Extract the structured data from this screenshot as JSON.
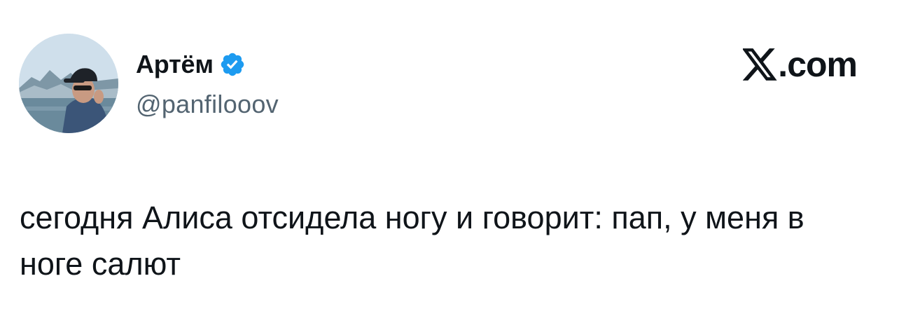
{
  "author": {
    "display_name": "Артём",
    "handle": "@panfilooov",
    "verified": true,
    "verified_icon": "verified-badge-icon",
    "avatar": "profile-photo"
  },
  "brand": {
    "logo_icon": "x-logo-icon",
    "domain": ".com"
  },
  "tweet": {
    "text": "сегодня Алиса отсидела ногу и говорит: пап, у меня в ноге салют"
  },
  "colors": {
    "text_primary": "#0f1419",
    "text_secondary": "#536471",
    "verified_blue": "#1d9bf0",
    "background": "#ffffff"
  }
}
